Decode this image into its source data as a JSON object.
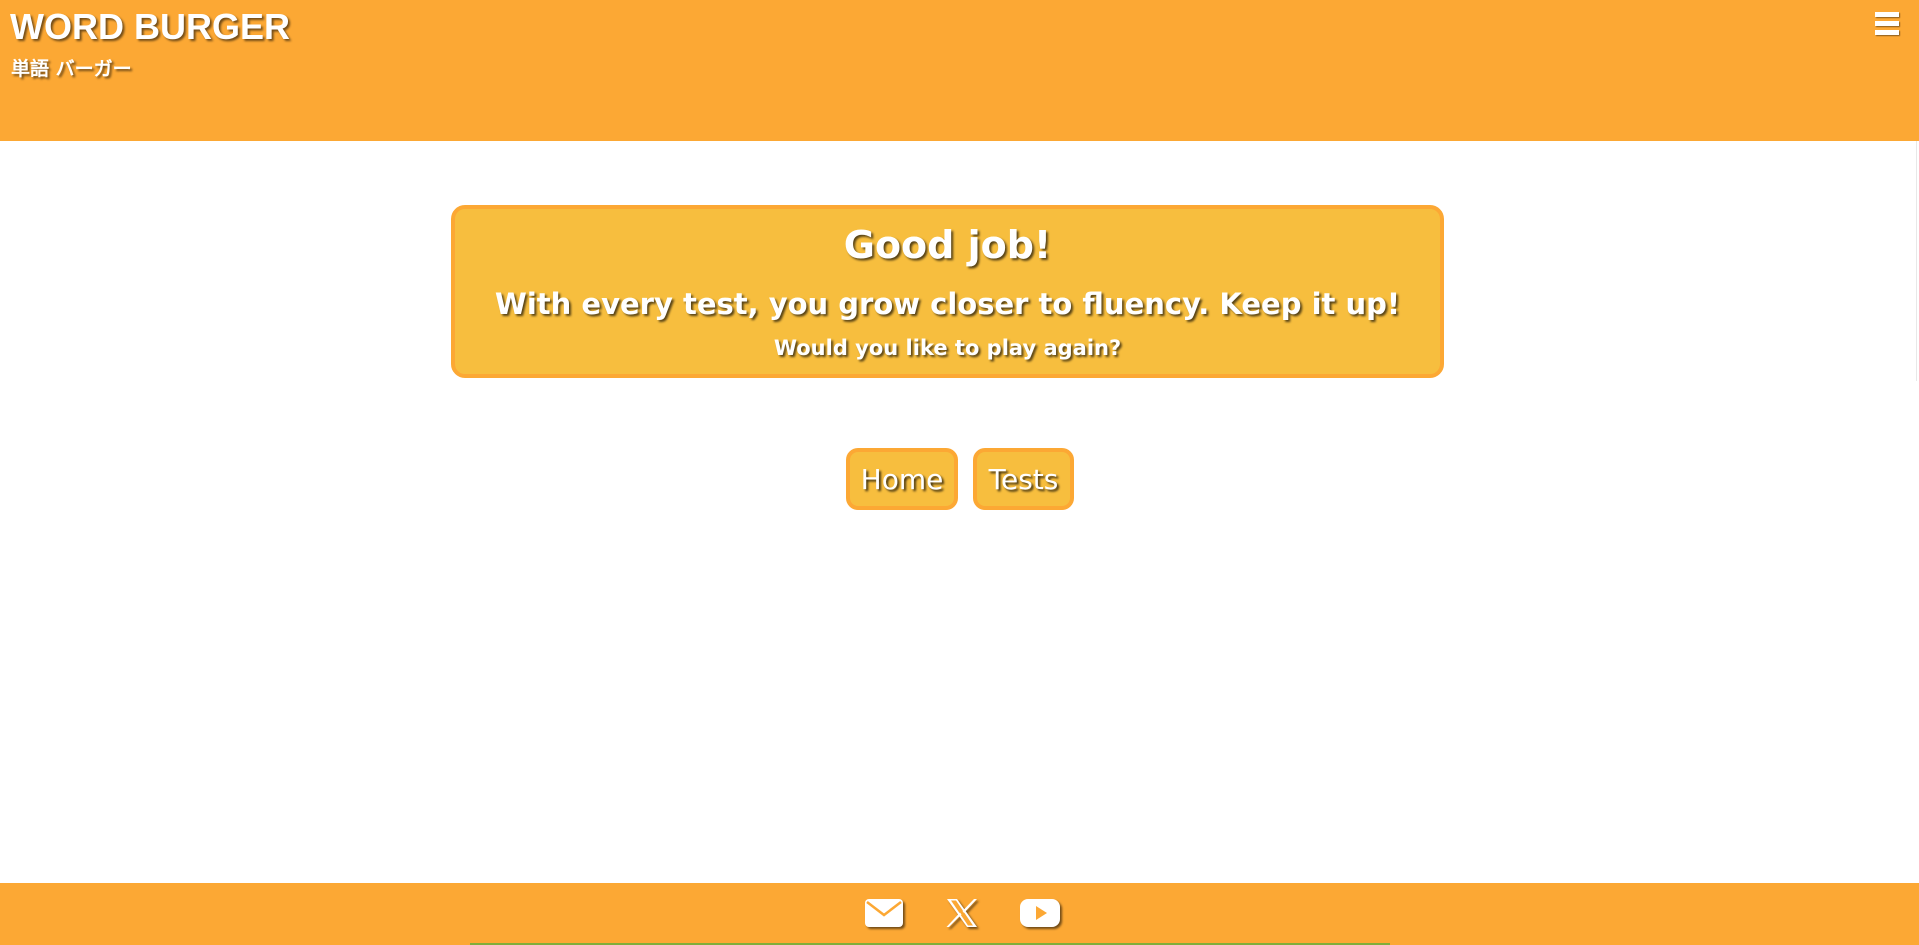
{
  "header": {
    "title": "WORD BURGER",
    "subtitle": "単語 バーガー",
    "menu_icon": "hamburger-menu-icon"
  },
  "result": {
    "heading": "Good job!",
    "message": "With every test, you grow closer to fluency. Keep it up!",
    "question": "Would you like to play again?"
  },
  "actions": {
    "home_label": "Home",
    "tests_label": "Tests"
  },
  "footer": {
    "links": [
      {
        "icon": "mail-icon"
      },
      {
        "icon": "x-icon"
      },
      {
        "icon": "youtube-icon"
      }
    ]
  },
  "colors": {
    "header_bg": "#fca834",
    "card_bg": "#f7be3e",
    "card_border": "#fca834",
    "text": "#ffffff"
  }
}
